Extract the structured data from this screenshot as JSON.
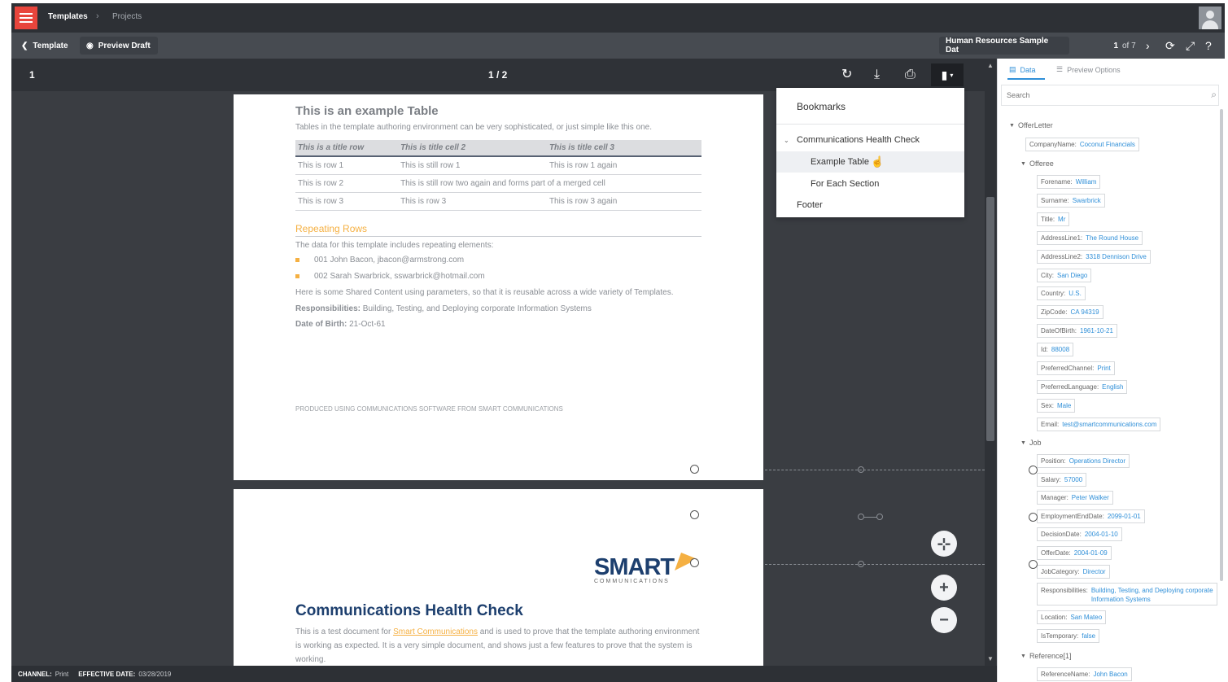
{
  "topbar": {
    "breadcrumb_1": "Templates",
    "breadcrumb_sep": "›",
    "breadcrumb_2": "Projects"
  },
  "subbar": {
    "back_label": "Template",
    "preview_label": "Preview Draft",
    "dataset": "Human Resources Sample Dat",
    "page_current": "1",
    "page_of": "of 7"
  },
  "viewer": {
    "page_number": "1",
    "page_count": "1 / 2"
  },
  "page1": {
    "title": "This is an example Table",
    "subtitle": "Tables in the template authoring environment can be very sophisticated, or just simple like this one.",
    "table": {
      "headers": [
        "This is a title row",
        "This is title cell 2",
        "This is title cell 3"
      ],
      "rows": [
        [
          "This is row 1",
          "This is still row 1",
          "This is row 1 again"
        ],
        [
          "This is row 2",
          "This is still row two again and forms part of a merged cell",
          ""
        ],
        [
          "This is row 3",
          "This is row 3",
          "This is row 3 again"
        ]
      ]
    },
    "repeating_title": "Repeating Rows",
    "repeating_intro": "The data for this template includes repeating elements:",
    "bullets": [
      "001 John Bacon, jbacon@armstrong.com",
      "002 Sarah Swarbrick, sswarbrick@hotmail.com"
    ],
    "shared_content": "Here is some Shared Content using parameters, so that it is reusable across a wide variety of Templates.",
    "resp_label": "Responsibilities:",
    "resp_value": " Building, Testing, and Deploying corporate Information Systems",
    "dob_label": "Date of Birth:",
    "dob_value": " 21-Oct-61",
    "footer": "PRODUCED USING COMMUNICATIONS SOFTWARE FROM SMART COMMUNICATIONS"
  },
  "page2": {
    "logo_main": "SMART",
    "logo_sub": "COMMUNICATIONS",
    "title": "Communications Health Check",
    "body_1": "This is a test document for ",
    "body_link": "Smart Communications",
    "body_2": " and is used to prove that the template authoring environment is working as expected. It is a very simple document, and shows just a few features to prove that the system is working."
  },
  "bookmarks": {
    "title": "Bookmarks",
    "items": [
      "Communications Health Check",
      "Example Table",
      "For Each Section",
      "Footer"
    ]
  },
  "statusbar": {
    "channel_label": "CHANNEL:",
    "channel_value": "Print",
    "date_label": "EFFECTIVE DATE:",
    "date_value": "03/28/2019"
  },
  "rpanel": {
    "tab_data": "Data",
    "tab_options": "Preview Options",
    "search_placeholder": "Search",
    "root": "OfferLetter",
    "company": {
      "k": "CompanyName:",
      "v": "Coconut Financials"
    },
    "offeree": "Offeree",
    "offeree_fields": [
      {
        "k": "Forename:",
        "v": "William"
      },
      {
        "k": "Surname:",
        "v": "Swarbrick"
      },
      {
        "k": "Title:",
        "v": "Mr"
      },
      {
        "k": "AddressLine1:",
        "v": "The Round House"
      },
      {
        "k": "AddressLine2:",
        "v": "3318 Dennison Drive"
      },
      {
        "k": "City:",
        "v": "San Diego"
      },
      {
        "k": "Country:",
        "v": "U.S."
      },
      {
        "k": "ZipCode:",
        "v": "CA 94319"
      },
      {
        "k": "DateOfBirth:",
        "v": "1961-10-21"
      },
      {
        "k": "Id:",
        "v": "88008"
      },
      {
        "k": "PreferredChannel:",
        "v": "Print"
      },
      {
        "k": "PreferredLanguage:",
        "v": "English"
      },
      {
        "k": "Sex:",
        "v": "Male"
      },
      {
        "k": "Email:",
        "v": "test@smartcommunications.com"
      }
    ],
    "job": "Job",
    "job_fields": [
      {
        "k": "Position:",
        "v": "Operations Director"
      },
      {
        "k": "Salary:",
        "v": "57000"
      },
      {
        "k": "Manager:",
        "v": "Peter Walker"
      },
      {
        "k": "EmploymentEndDate:",
        "v": "2099-01-01"
      },
      {
        "k": "DecisionDate:",
        "v": "2004-01-10"
      },
      {
        "k": "OfferDate:",
        "v": "2004-01-09"
      },
      {
        "k": "JobCategory:",
        "v": "Director"
      },
      {
        "k": "Responsibilities:",
        "v": "Building, Testing, and Deploying corporate Information Systems"
      },
      {
        "k": "Location:",
        "v": "San Mateo"
      },
      {
        "k": "IsTemporary:",
        "v": "false"
      }
    ],
    "reference": "Reference[1]",
    "reference_fields": [
      {
        "k": "ReferenceName:",
        "v": "John Bacon"
      }
    ]
  }
}
